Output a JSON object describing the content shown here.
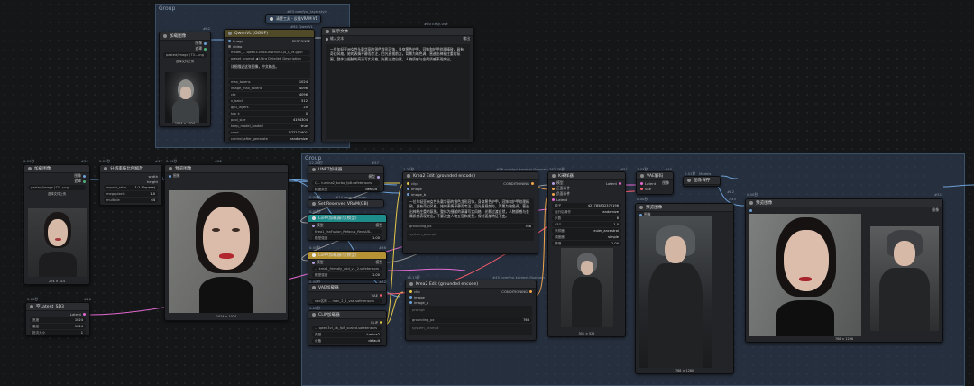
{
  "groups": [
    {
      "title": "Group"
    },
    {
      "title": "Group"
    }
  ],
  "badges": {
    "top1": "#63 comfyui_layerstyle",
    "top2": "#61 QwenVL",
    "right1": "#60 Easy-Use",
    "flux": "#56 comfyui-kontext-fluxmain",
    "flux2": "#45 comfyui-kontext-fluxmain"
  },
  "nodes": {
    "load_top": {
      "id": "#62",
      "title": "加载图像",
      "out1": "图像",
      "out2": "遮罩",
      "widget": "pasted/image (73...png",
      "upload": "选择文件上传",
      "caption": "1024 × 1024"
    },
    "qwen_header": {
      "id": "#61",
      "title": "Qwen3-VL 图像反推",
      "sub": "清楚工具 - 反推VRAM V1"
    },
    "qwen": {
      "title": "QwenVL (GGUF)",
      "in1": "image",
      "in2": "video",
      "out": "RESPONSE",
      "model": "model_... qwen3-vl-8b-instruct-Q4_K_M.gguf",
      "preset": "preset_prompt ◀ Ultra Detailed Description",
      "custom": "详细描述这张图像，中文输出。",
      "params": [
        {
          "k": "max_tokens",
          "v": "1024"
        },
        {
          "k": "image_max_tokens",
          "v": "4096"
        },
        {
          "k": "ctx",
          "v": "4096"
        },
        {
          "k": "n_batch",
          "v": "512"
        },
        {
          "k": "gpu_layers",
          "v": "20"
        },
        {
          "k": "top_k",
          "v": "0"
        },
        {
          "k": "pool_size",
          "v": "4194304"
        },
        {
          "k": "keep_model_loaded",
          "v": "true"
        },
        {
          "k": "seed",
          "v": "672231601"
        },
        {
          "k": "control_after_generate",
          "v": "randomize"
        }
      ]
    },
    "show_text": {
      "title": "展示文本",
      "in": "输入文本",
      "out": "输出",
      "text": "一位年轻亚洲女性头戴华丽的银色龙形冠饰，身穿黑色护甲，冠饰和护甲纹理精致，具有奇幻风格。她的表情平静而专注，目光直视前方。背景为暗色调，营造出神秘庄重的氛围。整体为细腻的高清写实风格，光影过渡自然，人物质感与金属质感表现突出。"
    },
    "load_left": {
      "id": "#52",
      "title": "加载图像",
      "out1": "图像",
      "out2": "遮罩",
      "widget": "pasted/image (73...png",
      "upload": "选择文件上传",
      "caption": "274 × 314",
      "time": "0.01秒"
    },
    "scale": {
      "id": "#47",
      "title": "分辨率按比例缩放",
      "out1": "width",
      "out2": "height",
      "w1k": "aspect_ratio",
      "w1v": "1:1 (Square)",
      "w2k": "megapixels",
      "w2v": "1.0",
      "w3k": "multiple",
      "w3v": "64",
      "time": "0.01秒"
    },
    "preview_left": {
      "id": "#82",
      "title": "预览图像",
      "in": "图像",
      "caption": "1024 × 1024",
      "time": "0.01秒"
    },
    "latent": {
      "id": "#46",
      "title": "空Latent_SD3",
      "out": "Latent",
      "w1k": "宽度",
      "w1v": "1024",
      "w2k": "高度",
      "w2v": "1024",
      "w3k": "批次大小",
      "w3v": "1",
      "time": "0.00秒"
    },
    "unet": {
      "id": "#57",
      "title": "UNET加载器",
      "out": "模型",
      "w1": "Q... lumina2_turbo_fp8.safetensors",
      "w2k": "精度类型",
      "w2v": "default",
      "time": "22.26秒"
    },
    "vram": {
      "id": "#58",
      "title": "Set Reserved VRAM(GB)",
      "time": "0.00秒",
      "tag": "#14 reserve-vram"
    },
    "lora1": {
      "id": "#55",
      "title": "LoRA加载器(仅模型)",
      "in": "模型",
      "out": "模型",
      "w1": "Krea1_fanFusion_Refocus_RedsUB...",
      "w2k": "模型强度",
      "w2v": "1.00",
      "time": "0.00秒"
    },
    "lora2": {
      "id": "#56",
      "title": "LoRA加载器(仅模型)",
      "in": "模型",
      "out": "模型",
      "w1": "... krea1_friendly_add_v1_2.safetensors",
      "w2k": "模型强度",
      "w2v": "1.00",
      "time": "0.00秒"
    },
    "vae": {
      "id": "#42",
      "title": "VAE加载器",
      "out": "VAE",
      "w1": "vae名称 ... man_2_1_vae.safetensors",
      "time": "0.00秒"
    },
    "clip": {
      "id": "#41",
      "title": "CLIP加载器",
      "out": "CLIP",
      "w1": "... qwen3vl_4b_fp8_scaled.safetensors",
      "w2k": "类型",
      "w2v": "lumina2",
      "w3k": "设备",
      "w3v": "default",
      "time": "1.02秒"
    },
    "krea1": {
      "title": "Krea2 Edit (grounded encode)",
      "in1": "clip",
      "in2": "image",
      "in3": "image_b",
      "out": "CONDITIONING",
      "text": "一位年轻亚洲女性头戴华丽的银色龙形冠饰，身穿黑色护甲，冠饰和护甲纹理精致，具有奇幻风格。她的表情平静而专注，目光直视前方。背景为暗色调，营造出神秘庄重的氛围。整体为细腻的高清写实风格，光影过渡自然，人物质感与金属质感表现突出。不要改变人物五官和发型，保持面部特征不变。",
      "w1k": "grounding_px",
      "w1v": "768",
      "ph": "system_prompt",
      "time": "1.26秒"
    },
    "krea2": {
      "title": "Krea2 Edit (grounded encode)",
      "in1": "clip",
      "in2": "image",
      "in3": "image_b",
      "out": "CONDITIONING",
      "ph1": "prompt",
      "w1k": "grounding_px",
      "w1v": "768",
      "ph2": "system_prompt",
      "time": "18.13秒"
    },
    "ksampler": {
      "id": "#51",
      "title": "K采样器",
      "in1": "模型",
      "in2": "正面条件",
      "in3": "负面条件",
      "in4": "Latent",
      "out": "Latent",
      "params": [
        {
          "k": "种子",
          "v": "421785832372196"
        },
        {
          "k": "运行后操作",
          "v": "randomize"
        },
        {
          "k": "步数",
          "v": "8"
        },
        {
          "k": "CFG",
          "v": "1.0"
        },
        {
          "k": "采样器",
          "v": "euler_ancestral"
        },
        {
          "k": "调度器",
          "v": "simple"
        },
        {
          "k": "降噪",
          "v": "1.00"
        }
      ],
      "caption": "301 × 522",
      "time": "262.76秒"
    },
    "vaedecode": {
      "id": "#40",
      "title": "VAE解码",
      "in1": "Latent",
      "in2": "vae",
      "out": "图像",
      "time": "1.03秒"
    },
    "save": {
      "id": "#12",
      "title": "图像保存",
      "in": "图像",
      "tag": "Models",
      "time": "0.01秒"
    },
    "preview_mid": {
      "id": "#45",
      "title": "预览图像",
      "in": "图像",
      "caption": "768 × 1280",
      "time": "0.00秒"
    },
    "preview_right": {
      "id": "#51",
      "title": "预览图像",
      "in": "图像",
      "caption": "768 × 1296",
      "time": "0.00秒"
    },
    "preview_ghost": {
      "title": "预览图像"
    }
  }
}
